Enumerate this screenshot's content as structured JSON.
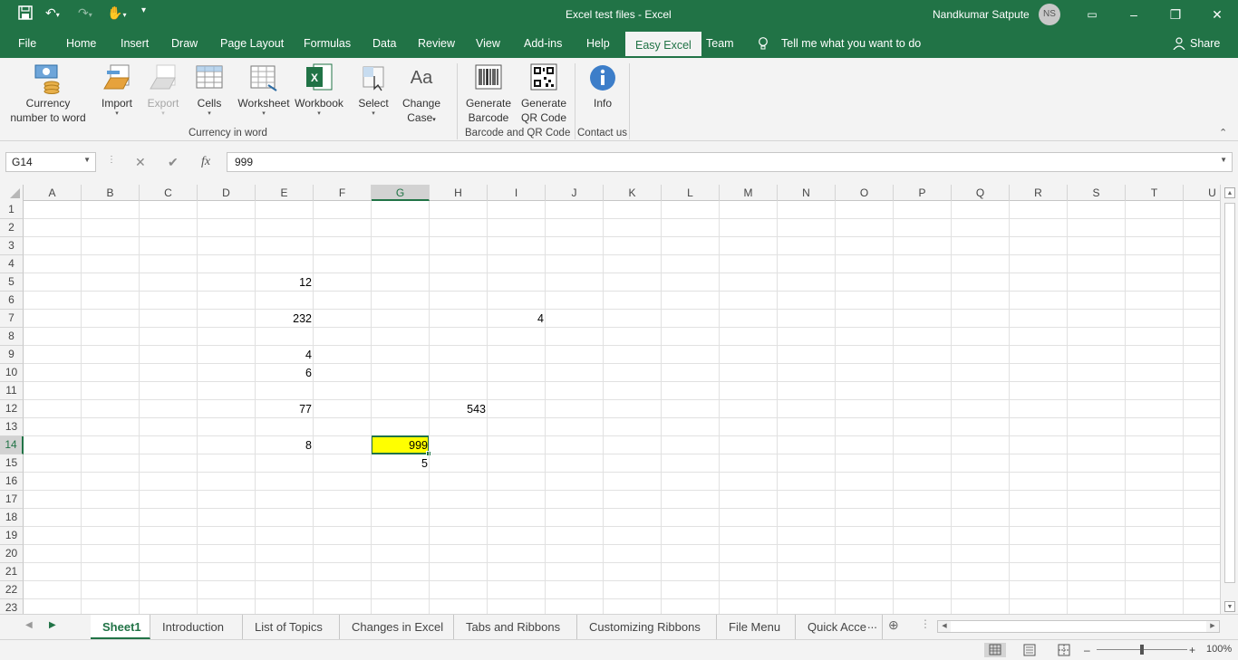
{
  "window": {
    "title": "Excel test files  -  Excel",
    "user": "Nandkumar Satpute",
    "initials": "NS",
    "minimize": "–",
    "maximize": "❐",
    "close": "✕"
  },
  "menu": [
    "File",
    "Home",
    "Insert",
    "Draw",
    "Page Layout",
    "Formulas",
    "Data",
    "Review",
    "View",
    "Add-ins",
    "Help",
    "Easy Excel",
    "Team"
  ],
  "active_menu": "Easy Excel",
  "tell_me": "Tell me what you want to do",
  "share": "Share",
  "ribbon": {
    "currency": [
      "Currency",
      "number to word"
    ],
    "import": "Import",
    "export": "Export",
    "cells": "Cells",
    "worksheet": "Worksheet",
    "workbook": "Workbook",
    "select": "Select",
    "change_case": [
      "Change",
      "Case"
    ],
    "gen_barcode": [
      "Generate",
      "Barcode"
    ],
    "gen_qr": [
      "Generate",
      "QR Code"
    ],
    "info": "Info",
    "groups": [
      "Currency in word",
      "Barcode and QR Code",
      "Contact us"
    ]
  },
  "formula": {
    "namebox": "G14",
    "value": "999",
    "fx": "fx",
    "cancel": "✕",
    "enter": "✔"
  },
  "columns": [
    "A",
    "B",
    "C",
    "D",
    "E",
    "F",
    "G",
    "H",
    "I",
    "J",
    "K",
    "L",
    "M",
    "N",
    "O",
    "P",
    "Q",
    "R",
    "S",
    "T",
    "U"
  ],
  "selected_column": "G",
  "rows": [
    "1",
    "2",
    "3",
    "4",
    "5",
    "6",
    "7",
    "8",
    "9",
    "10",
    "11",
    "12",
    "13",
    "14",
    "15",
    "16",
    "17",
    "18",
    "19",
    "20",
    "21",
    "22",
    "23"
  ],
  "selected_row": "14",
  "cells": [
    {
      "ref": "E5",
      "value": "12"
    },
    {
      "ref": "E7",
      "value": "232"
    },
    {
      "ref": "I7",
      "value": "4"
    },
    {
      "ref": "E9",
      "value": "4"
    },
    {
      "ref": "E10",
      "value": "6"
    },
    {
      "ref": "E12",
      "value": "77"
    },
    {
      "ref": "H12",
      "value": "543"
    },
    {
      "ref": "E14",
      "value": "8"
    },
    {
      "ref": "G14",
      "value": "999"
    },
    {
      "ref": "G15",
      "value": "5"
    }
  ],
  "active_cell": {
    "ref": "G14",
    "fill": "#ffff00"
  },
  "sheets": [
    "Sheet1",
    "Introduction",
    "List of Topics",
    "Changes in Excel",
    "Tabs and Ribbons",
    "Customizing Ribbons",
    "File Menu",
    "Quick Acce"
  ],
  "active_sheet": "Sheet1",
  "more_sheets": "...",
  "zoom": "100%",
  "colors": {
    "accent": "#217346",
    "highlight": "#ffff00"
  }
}
